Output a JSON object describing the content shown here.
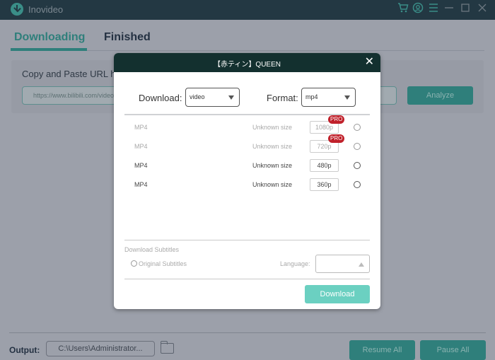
{
  "app": {
    "title": "Inovideo",
    "titlebar_icons": [
      "cart-icon",
      "account-icon",
      "menu-icon",
      "minimize-icon",
      "maximize-icon",
      "close-icon"
    ]
  },
  "tabs": [
    {
      "label": "Downloading",
      "active": true
    },
    {
      "label": "Finished",
      "active": false
    }
  ],
  "url_panel": {
    "label": "Copy and Paste URL here",
    "input_value": "https://www.bilibili.com/video",
    "analyze_label": "Analyze"
  },
  "footer": {
    "output_label": "Output:",
    "output_path": "C:\\Users\\Administrator...",
    "resume_all_label": "Resume All",
    "pause_all_label": "Pause All"
  },
  "modal": {
    "title": "【赤ティン】QUEEN",
    "close_glyph": "✕",
    "download_label": "Download:",
    "download_value": "video",
    "format_label": "Format:",
    "format_value": "mp4",
    "rows": [
      {
        "format": "MP4",
        "size": "Unknown size",
        "resolution": "1080p",
        "pro": true,
        "badge": "PRO"
      },
      {
        "format": "MP4",
        "size": "Unknown size",
        "resolution": "720p",
        "pro": true,
        "badge": "PRO"
      },
      {
        "format": "MP4",
        "size": "Unknown size",
        "resolution": "480p",
        "pro": false
      },
      {
        "format": "MP4",
        "size": "Unknown size",
        "resolution": "360p",
        "pro": false
      }
    ],
    "subtitles": {
      "title": "Download Subtitles",
      "option_label": "Original Subtitles",
      "language_label": "Language:",
      "language_value": ""
    },
    "download_button_label": "Download"
  },
  "colors": {
    "accent": "#2f7f7b",
    "titlebar": "#233843",
    "modal_header": "#13302f",
    "pro_badge": "#c0202a",
    "download_button": "#6bd0c1"
  }
}
